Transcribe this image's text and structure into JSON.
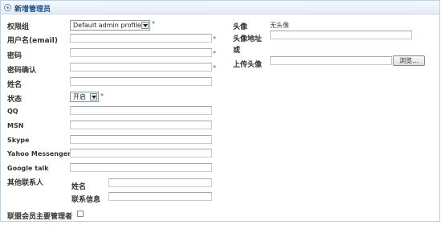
{
  "title": "新增管理员",
  "permission_group": {
    "label": "权限组",
    "selected": "Default admin profile",
    "required": "*"
  },
  "username": {
    "label": "用户名(email)",
    "value": "",
    "required": "*"
  },
  "password": {
    "label": "密码",
    "value": "",
    "required": "*"
  },
  "password_confirm": {
    "label": "密码确认",
    "value": "",
    "required": "*"
  },
  "name": {
    "label": "姓名",
    "value": ""
  },
  "status": {
    "label": "状态",
    "selected": "开启",
    "required": "*"
  },
  "qq": {
    "label": "QQ",
    "value": ""
  },
  "msn": {
    "label": "MSN",
    "value": ""
  },
  "skype": {
    "label": "Skype",
    "value": ""
  },
  "yahoo": {
    "label": "Yahoo Messenger",
    "value": ""
  },
  "gtalk": {
    "label": "Google talk",
    "value": ""
  },
  "other_contact": {
    "label": "其他联系人",
    "name_label": "姓名",
    "info_label": "联系信息"
  },
  "main_admin": {
    "label": "联盟会员主要管理者",
    "checked": false
  },
  "avatar": {
    "label": "头像",
    "value": "无头像"
  },
  "avatar_url": {
    "label_line1": "头像地址",
    "label_line2": "或",
    "value": ""
  },
  "upload_avatar": {
    "label": "上传头像",
    "browse_label": "浏览..."
  }
}
